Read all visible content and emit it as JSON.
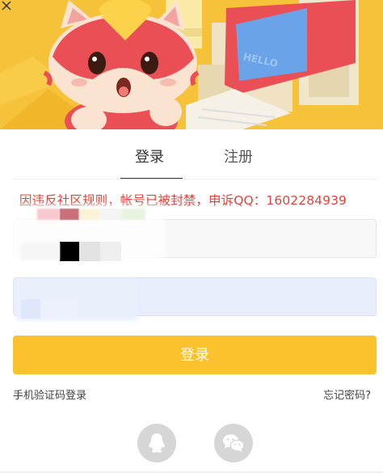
{
  "tabs": {
    "login": "登录",
    "register": "注册"
  },
  "error": {
    "message": "因违反社区规则，帐号已被封禁，申诉QQ：1602284939"
  },
  "form": {
    "username_value": "",
    "password_value": ""
  },
  "login_button": {
    "label": "登录"
  },
  "links": {
    "sms_login": "手机验证码登录",
    "forgot_password": "忘记密码?"
  },
  "banner": {
    "screen_text": "HELLO"
  },
  "colors": {
    "accent": "#fcc22e",
    "error": "#e8413c",
    "banner_bg": "#f7c43a"
  }
}
